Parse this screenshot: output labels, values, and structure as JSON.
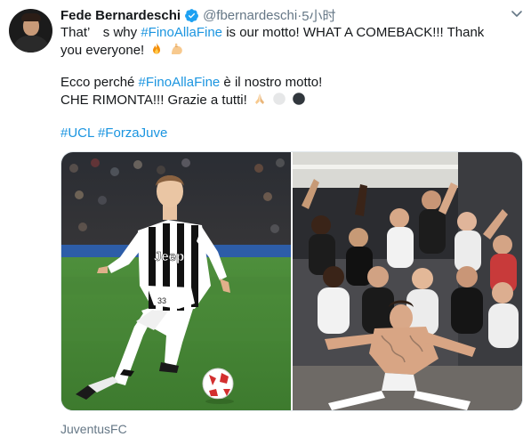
{
  "tweet": {
    "author_name": "Fede Bernardeschi",
    "handle": "@fbernardeschi",
    "separator": " · ",
    "time": "5小时",
    "line1_a": "That’　s why ",
    "line1_tag": "#FinoAllaFine",
    "line1_b": " is our motto! WHAT A COMEBACK!!! Thank",
    "line2": "you everyone!",
    "line3_a": "Ecco perché ",
    "line3_tag": "#FinoAllaFine",
    "line3_b": " è il nostro motto!",
    "line4": "CHE RIMONTA!!! Grazie a tutti!",
    "hashtag_1": "#UCL",
    "hashtag_2": "#ForzaJuve",
    "source": "JuventusFC"
  },
  "photo_left": {
    "kit_sponsor": "Jeep",
    "shorts_number": "33"
  },
  "colors": {
    "link": "#1b95e0",
    "text": "#14171a",
    "muted": "#657786",
    "verified": "#1da1f2"
  },
  "icons": [
    "verified-badge-icon",
    "chevron-down-icon",
    "fire-emoji",
    "flexed-biceps-emoji",
    "folded-hands-emoji",
    "white-circle-emoji",
    "black-circle-emoji"
  ]
}
